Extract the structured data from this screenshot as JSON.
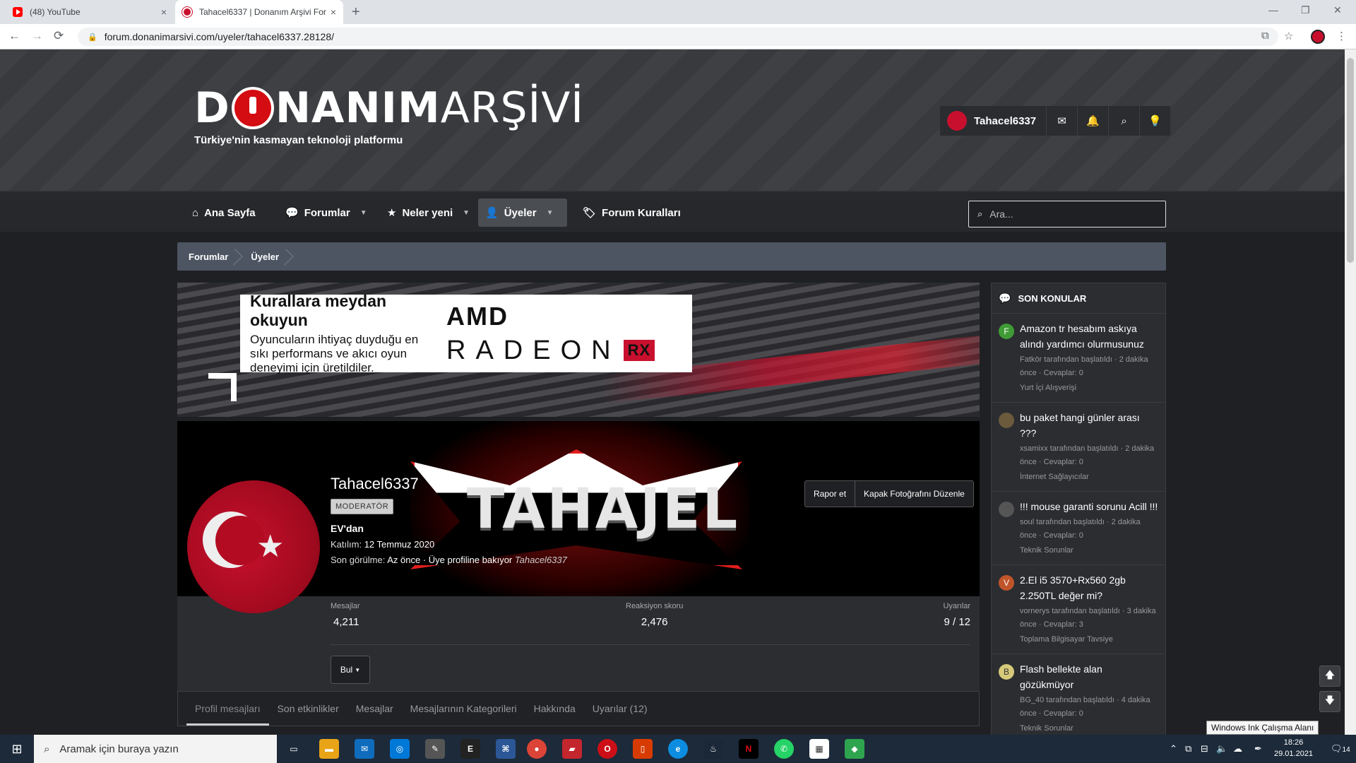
{
  "browser": {
    "tabs": [
      {
        "title": "(48) YouTube",
        "close": "×"
      },
      {
        "title": "Tahacel6337 | Donanım Arşivi For",
        "close": "×"
      }
    ],
    "new_tab": "+",
    "url": "forum.donanimarsivi.com/uyeler/tahacel6337.28128/",
    "nav": {
      "back": "←",
      "forward": "→",
      "reload": "⟳"
    },
    "window": {
      "minimize": "—",
      "restore": "❐",
      "close": "✕"
    }
  },
  "site": {
    "logo_d": "D",
    "logo_rest_bold": "NANIM",
    "logo_light": " ARŞİVİ",
    "tagline": "Türkiye'nin kasmayan teknoloji platformu",
    "username": "Tahacel6337"
  },
  "nav": {
    "items": [
      {
        "label": "Ana Sayfa",
        "icon": "⌂"
      },
      {
        "label": "Forumlar",
        "icon": "💬"
      },
      {
        "label": "Neler yeni",
        "icon": "★"
      },
      {
        "label": "Üyeler",
        "icon": "👤"
      },
      {
        "label": "Forum Kuralları",
        "icon": "🏷"
      }
    ],
    "search_placeholder": "Ara..."
  },
  "breadcrumb": [
    "Forumlar",
    "Üyeler"
  ],
  "ad": {
    "headline": "Kurallara meydan okuyun",
    "body": "Oyuncuların ihtiyaç duyduğu en sıkı performans ve akıcı oyun deneyimi için üretildiler.",
    "brand": "AMD",
    "product": "RADEON",
    "product_suffix": "RX"
  },
  "cover": {
    "text": "TAHAJEL"
  },
  "profile": {
    "name": "Tahacel6337",
    "badge": "MODERATÖR",
    "location": "EV'dan",
    "joined_label": "Katılım:",
    "joined_value": "12 Temmuz 2020",
    "seen_label": "Son görülme:",
    "seen_value": "Az önce · Üye profiline bakıyor",
    "seen_user": "Tahacel6337",
    "buttons": {
      "report": "Rapor et",
      "edit_cover": "Kapak Fotoğrafını Düzenle"
    },
    "stats": [
      {
        "label": "Mesajlar",
        "value": "4,211"
      },
      {
        "label": "Reaksiyon skoru",
        "value": "2,476"
      },
      {
        "label": "Uyarılar",
        "value": "9 / 12"
      }
    ],
    "find_button": "Bul",
    "tabs": [
      "Profil mesajları",
      "Son etkinlikler",
      "Mesajlar",
      "Mesajlarının Kategorileri",
      "Hakkında",
      "Uyarılar (12)"
    ]
  },
  "sidebar": {
    "title": "SON KONULAR",
    "threads": [
      {
        "avatar": "F",
        "color": "#3f9c35",
        "title": "Amazon tr hesabım askıya alındı yardımcı olurmusunuz",
        "meta": "Fatkör tarafından başlatıldı · 2 dakika önce · Cevaplar: 0",
        "forum": "Yurt İçi Alışverişi"
      },
      {
        "avatar": "",
        "color": "#6b5a3c",
        "title": "bu paket hangi günler arası ???",
        "meta": "xsamixx tarafından başlatıldı · 2 dakika önce · Cevaplar: 0",
        "forum": "İnternet Sağlayıcılar"
      },
      {
        "avatar": "",
        "color": "#555555",
        "title": "!!! mouse garanti sorunu Acill !!!",
        "meta": "soul tarafından başlatıldı · 2 dakika önce · Cevaplar: 0",
        "forum": "Teknik Sorunlar"
      },
      {
        "avatar": "V",
        "color": "#c0552a",
        "title": "2.El i5 3570+Rx560 2gb 2.250TL değer mi?",
        "meta": "vornerys tarafından başlatıldı · 3 dakika önce · Cevaplar: 3",
        "forum": "Toplama Bilgisayar Tavsiye"
      },
      {
        "avatar": "B",
        "color": "#d6c97a",
        "title": "Flash bellekte alan gözükmüyor",
        "meta": "BG_40 tarafından başlatıldı · 4 dakika önce · Cevaplar: 0",
        "forum": "Teknik Sorunlar"
      }
    ]
  },
  "float": {
    "up": "🡅",
    "down": "🡇"
  },
  "tooltip": "Windows Ink Çalışma Alanı",
  "taskbar": {
    "search_placeholder": "Aramak için buraya yazın",
    "time": "18:26",
    "date": "29.01.2021",
    "notifications": "14"
  }
}
